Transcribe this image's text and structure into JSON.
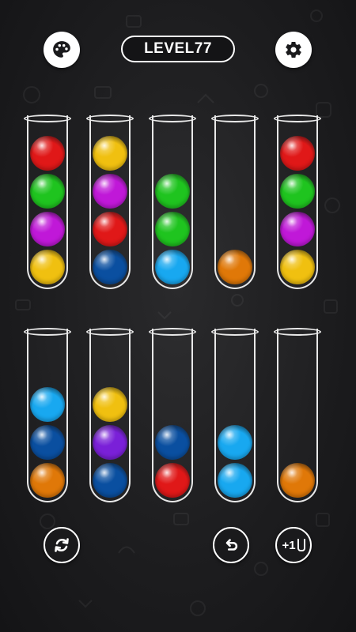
{
  "header": {
    "level_label": "LEVEL77",
    "theme_icon": "palette-icon",
    "settings_icon": "gear-icon"
  },
  "footer": {
    "restart_icon": "restart-icon",
    "undo_icon": "undo-icon",
    "add_tube_icon": "add-tube-icon",
    "add_tube_label": "+1"
  },
  "colors": {
    "red": "#e01818",
    "green": "#1fc41f",
    "purple": "#c018d8",
    "yellow": "#f0c010",
    "navy": "#0a4fa0",
    "skyblue": "#18a8f0",
    "orange": "#e07808",
    "violet": "#7a20d8"
  },
  "tubes": [
    {
      "balls": [
        "yellow",
        "purple",
        "green",
        "red"
      ]
    },
    {
      "balls": [
        "navy",
        "red",
        "purple",
        "yellow"
      ]
    },
    {
      "balls": [
        "skyblue",
        "green",
        "green"
      ]
    },
    {
      "balls": [
        "orange"
      ]
    },
    {
      "balls": [
        "yellow",
        "purple",
        "green",
        "red"
      ]
    },
    {
      "balls": [
        "orange",
        "navy",
        "skyblue"
      ]
    },
    {
      "balls": [
        "navy",
        "violet",
        "yellow"
      ]
    },
    {
      "balls": [
        "red",
        "navy"
      ]
    },
    {
      "balls": [
        "skyblue",
        "skyblue"
      ]
    },
    {
      "balls": [
        "orange"
      ]
    }
  ]
}
